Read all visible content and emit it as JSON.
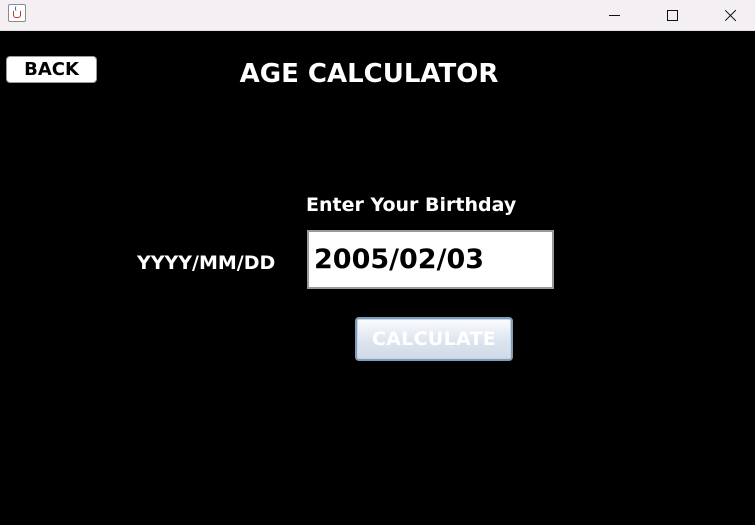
{
  "window": {
    "icon": "java-cup-icon",
    "controls": [
      "minimize-icon",
      "maximize-icon",
      "close-icon"
    ]
  },
  "header": {
    "back_label": "BACK",
    "title": "AGE CALCULATOR"
  },
  "form": {
    "prompt": "Enter Your Birthday",
    "format_label": "YYYY/MM/DD",
    "birthday_value": "2005/02/03",
    "calculate_label": "CALCULATE"
  },
  "colors": {
    "background": "#000000",
    "text": "#ffffff",
    "button_border": "#7f9db9"
  }
}
